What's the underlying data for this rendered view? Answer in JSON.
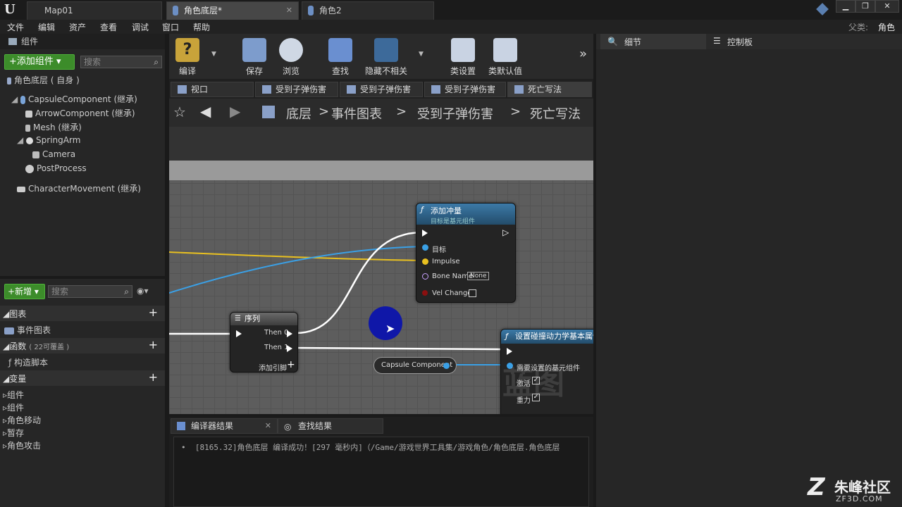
{
  "window": {
    "logo": "U",
    "tabs": [
      {
        "label": "Map01"
      },
      {
        "label": "角色底层*"
      },
      {
        "label": "角色2"
      }
    ],
    "parent_label": "父类:",
    "parent_value": "角色"
  },
  "menu": [
    "文件",
    "编辑",
    "资产",
    "查看",
    "调试",
    "窗口",
    "帮助"
  ],
  "components_panel": {
    "title": "组件",
    "add_button": "+添加组件 ▾",
    "search_placeholder": "搜索",
    "root": "角色底层 ( 自身 )",
    "items": [
      "CapsuleComponent (继承)",
      "ArrowComponent (继承)",
      "Mesh (继承)",
      "SpringArm",
      "Camera",
      "PostProcess",
      "CharacterMovement (继承)"
    ]
  },
  "mybp_panel": {
    "new_button": "+新增 ▾",
    "search_placeholder": "搜索",
    "sections": {
      "graphs": "图表",
      "event_graph": "事件图表",
      "functions": "函数",
      "functions_note": "( 22可覆盖 )",
      "construction": "构造脚本",
      "variables": "变量"
    },
    "variable_groups": [
      "组件",
      "组件",
      "角色移动",
      "暂存",
      "角色攻击"
    ]
  },
  "toolbar": {
    "compile": "编译",
    "save": "保存",
    "browse": "浏览",
    "find": "查找",
    "hide_unrelated": "隐藏不相关",
    "class_settings": "类设置",
    "class_defaults": "类默认值"
  },
  "graph_tabs": [
    "视口",
    "受到子弹伤害",
    "受到子弹伤害",
    "受到子弹伤害",
    "死亡写法"
  ],
  "breadcrumb": {
    "items": [
      "底层",
      "事件图表",
      "受到子弹伤害",
      "死亡写法"
    ],
    "separator": ">"
  },
  "nodes": {
    "add_impulse": {
      "title": "添加冲量",
      "subtitle": "目标是基元组件",
      "pins": {
        "target": "目标",
        "impulse": "Impulse",
        "bone_name": "Bone Name",
        "bone_value": "None",
        "vel_change": "Vel Change"
      }
    },
    "sequence": {
      "title": "序列",
      "then0": "Then 0",
      "then1": "Then 1",
      "add_pin": "添加引脚"
    },
    "set_physics": {
      "title": "设置碰撞动力学基本属性",
      "target": "需要设置的基元组件",
      "activate": "激活",
      "gravity": "重力"
    },
    "capsule_ref": "Capsule Component",
    "watermark": "蓝图"
  },
  "right_tabs": {
    "details": "细节",
    "control": "控制板"
  },
  "output": {
    "tabs": [
      "编译器结果",
      "查找结果"
    ],
    "log": "[8165.32]角色底层 编译成功！[297 毫秒内]（/Game/游戏世界工具集/游戏角色/角色底层.角色底层"
  },
  "site_watermark": {
    "name": "朱峰社区",
    "url": "ZF3D.COM"
  },
  "colors": {
    "exec_wire": "#ffffff",
    "object_wire": "#3aa0e6",
    "vector_wire": "#e8c020",
    "function_header": "#2d5d86",
    "cursor_circle": "#0f17a8"
  }
}
